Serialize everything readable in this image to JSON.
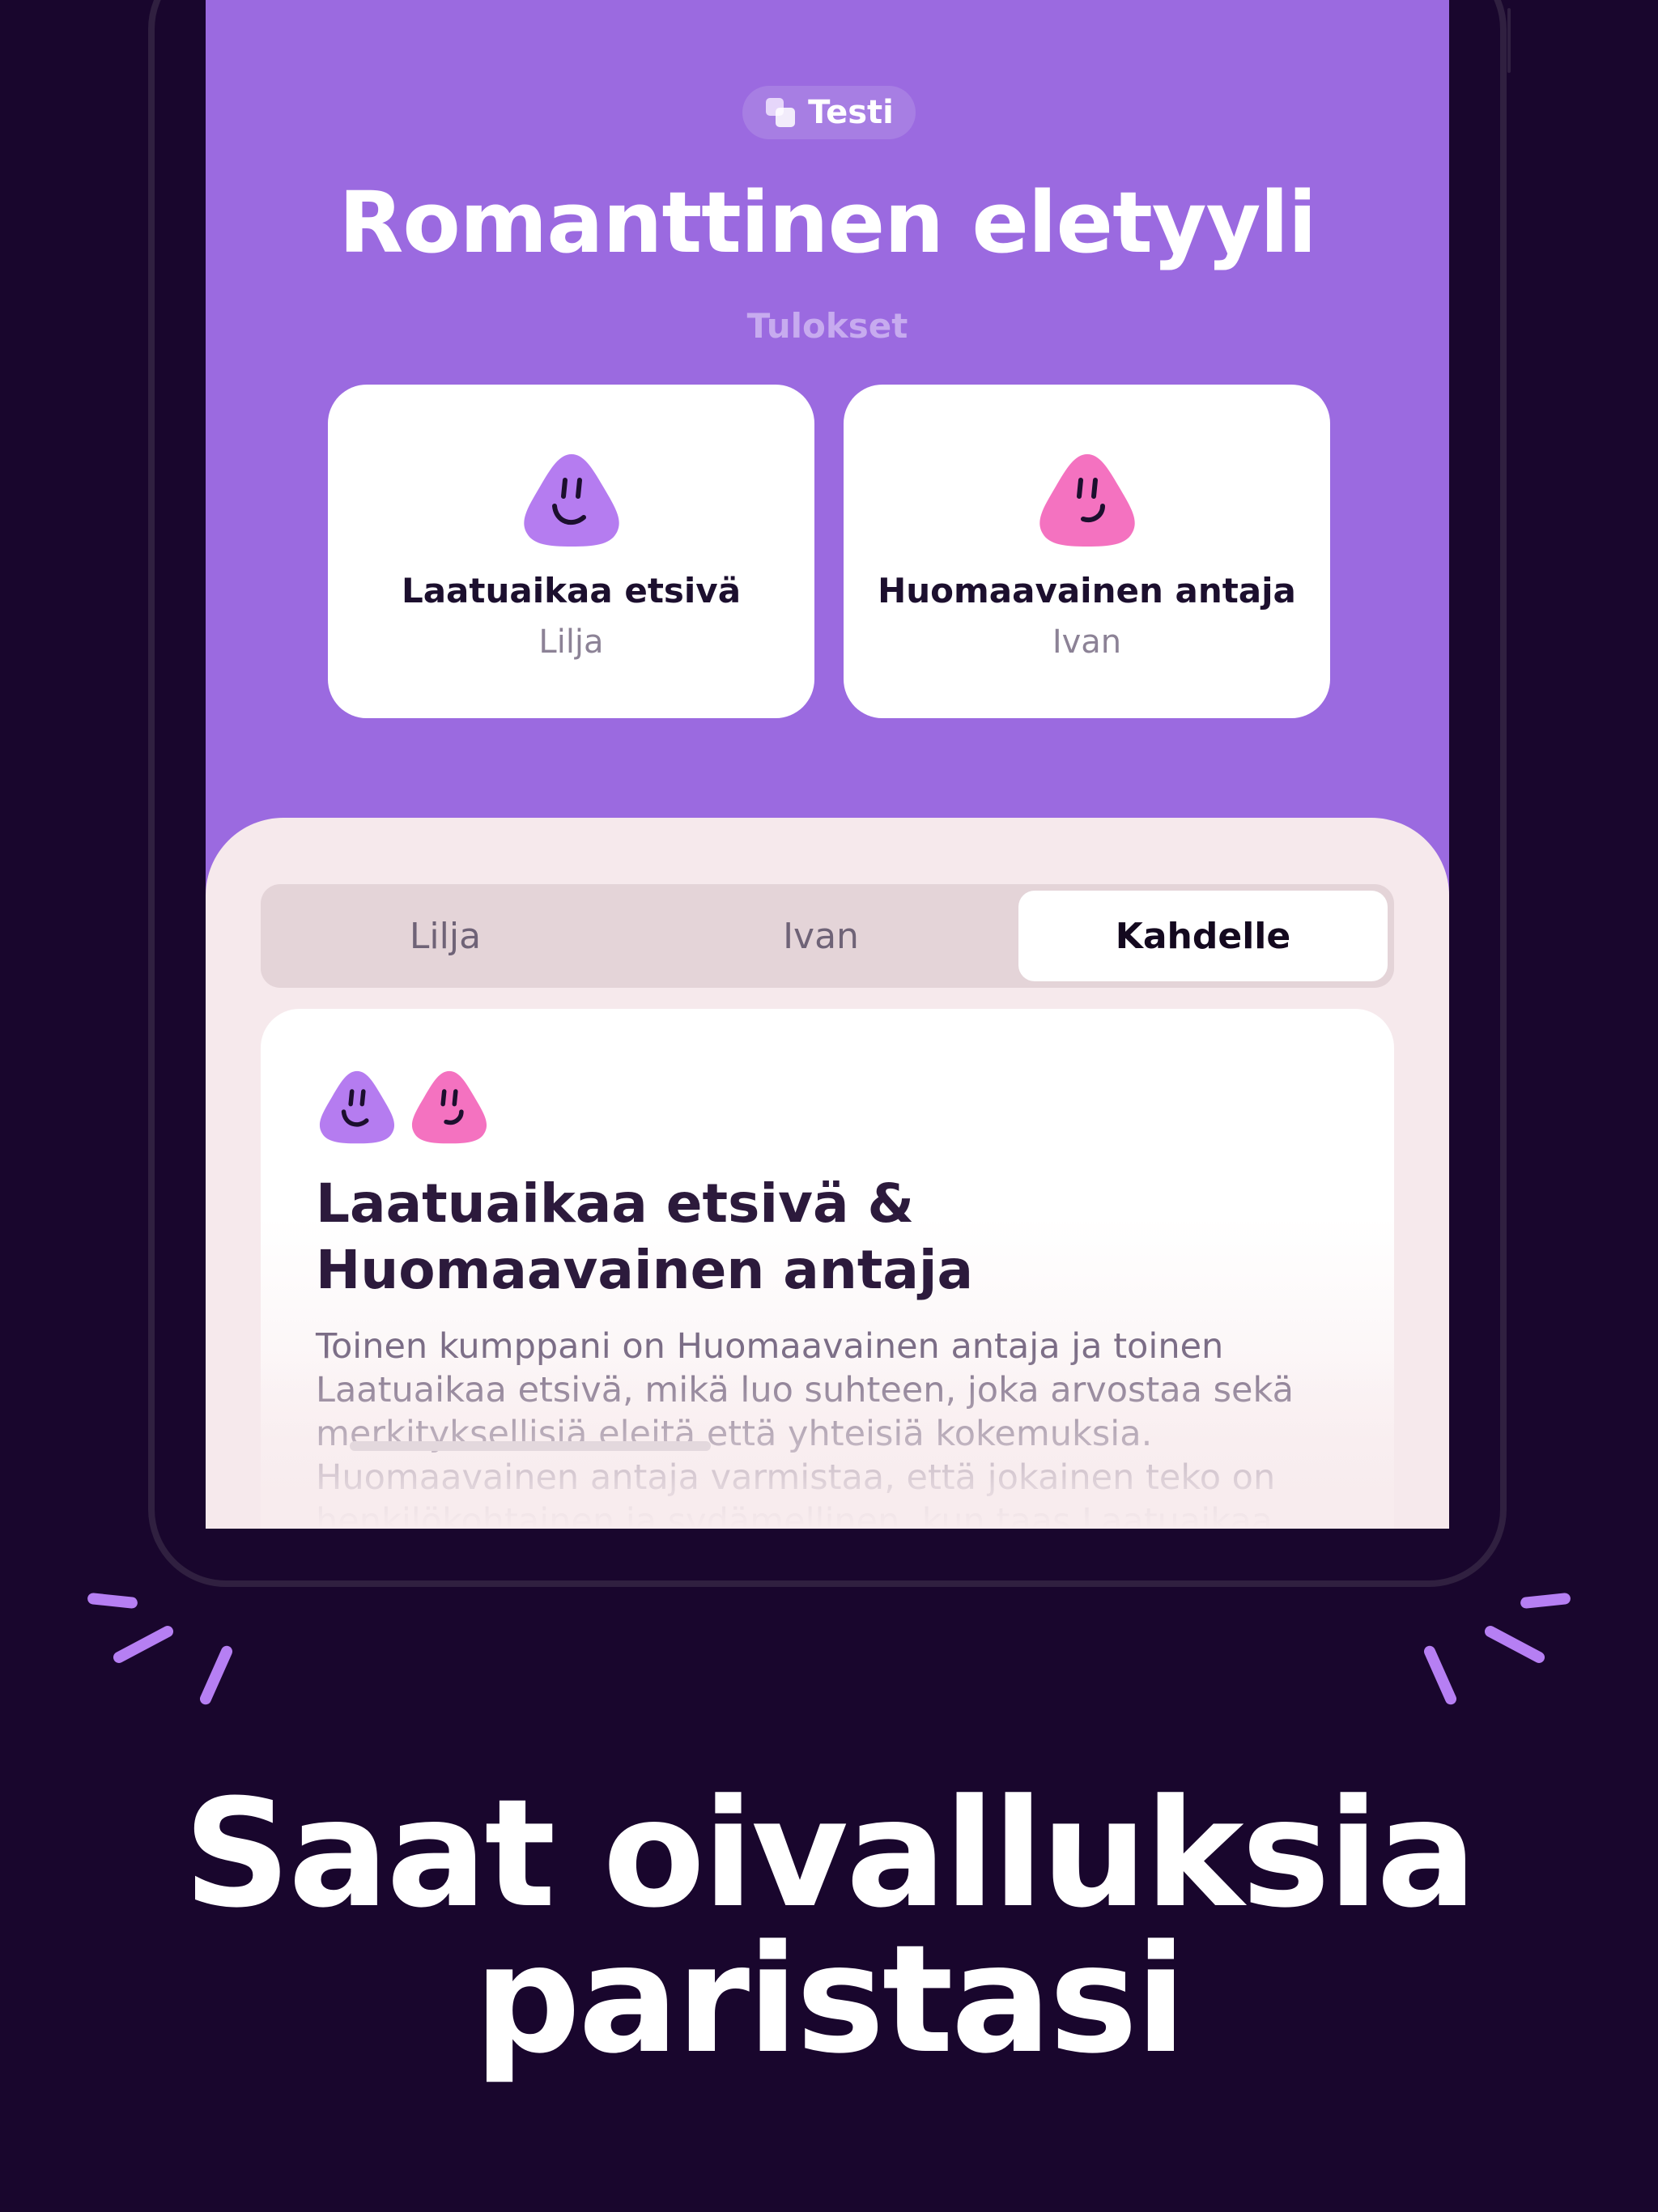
{
  "header": {
    "badge_label": "Testi",
    "title": "Romanttinen eletyyli",
    "subtitle": "Tulokset"
  },
  "results": [
    {
      "type": "Laatuaikaa etsivä",
      "person": "Lilja",
      "color": "#b57cf0"
    },
    {
      "type": "Huomaavainen antaja",
      "person": "Ivan",
      "color": "#f472c0"
    }
  ],
  "tabs": [
    {
      "label": "Lilja",
      "selected": false
    },
    {
      "label": "Ivan",
      "selected": false
    },
    {
      "label": "Kahdelle",
      "selected": true
    }
  ],
  "detail": {
    "title": "Laatuaikaa etsivä & Huomaavainen antaja",
    "body": "Toinen kumppani on Huomaavainen antaja ja toinen Laatuaikaa etsivä, mikä luo suhteen, joka arvostaa sekä merkityksellisiä eleitä että yhteisiä kokemuksia. Huomaavainen antaja varmistaa, että jokainen teko on henkilökohtainen ja sydämellinen, kun taas Laatuaikaa"
  },
  "tagline": {
    "line1": "Saat oivalluksia",
    "line2": "paristasi"
  },
  "colors": {
    "background": "#19062d",
    "screen": "#9b6ae0",
    "sheet": "#f6e9ec",
    "accent_purple": "#b57cf0",
    "accent_pink": "#f472c0"
  }
}
